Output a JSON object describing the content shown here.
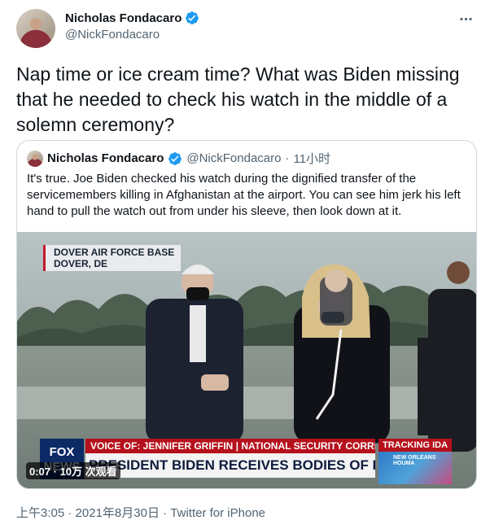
{
  "tweet": {
    "author_name": "Nicholas Fondacaro",
    "handle": "@NickFondacaro",
    "text": "Nap time or ice cream time? What was Biden missing that he needed to check his watch in the middle of a solemn ceremony?",
    "more_icon": "more-horizontal-icon"
  },
  "quote": {
    "author_name": "Nicholas Fondacaro",
    "handle": "@NickFondacaro",
    "separator": "·",
    "time": "11小时",
    "text": "It's true. Joe Biden checked his watch during the dignified transfer of the servicemembers killing in Afghanistan at the airport. You can see him jerk his left hand to pull the watch out from under his sleeve, then look down at it."
  },
  "video": {
    "location_line1": "DOVER AIR FORCE BASE",
    "location_line2": "DOVER, DE",
    "network_logo": "FOX NEWS",
    "voice_of": "VOICE OF: JENNIFER GRIFFIN | NATIONAL SECURITY CORRESPONDENT",
    "headline": "PRESIDENT BIDEN RECEIVES BODIES OF FALLEN TROOPS",
    "tracking": "TRACKING IDA",
    "tracking_map_label": "NEW ORLEANS HOUMA",
    "playback_badge": "0:07 · 10万 次观看"
  },
  "footer": {
    "time": "上午3:05",
    "sep1": " · ",
    "date": "2021年8月30日",
    "sep2": " · ",
    "source": "Twitter for iPhone"
  },
  "colors": {
    "verified": "#1d9bf0",
    "text": "#0f1419",
    "secondary": "#536471",
    "border": "#cfd9de",
    "fox_red": "#b5111c"
  }
}
